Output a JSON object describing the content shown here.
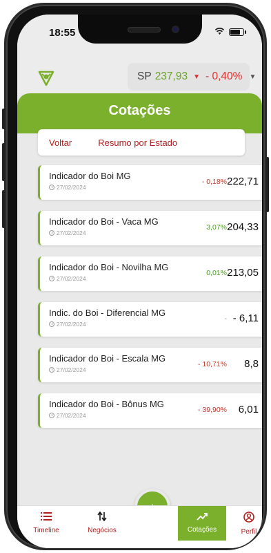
{
  "status": {
    "time": "18:55"
  },
  "header": {
    "quote_label": "SP",
    "quote_value": "237,93",
    "quote_change": "- 0,40%"
  },
  "page": {
    "title": "Cotações"
  },
  "subbar": {
    "back_label": "Voltar",
    "summary_label": "Resumo por Estado"
  },
  "items": [
    {
      "name": "Indicador do Boi MG",
      "date": "27/02/2024",
      "change": "- 0,18%",
      "trend": "negative",
      "price": "222,71"
    },
    {
      "name": "Indicador do Boi - Vaca MG",
      "date": "27/02/2024",
      "change": "3,07%",
      "trend": "positive",
      "price": "204,33"
    },
    {
      "name": "Indicador do Boi - Novilha MG",
      "date": "27/02/2024",
      "change": "0,01%",
      "trend": "positive",
      "price": "213,05"
    },
    {
      "name": "Indic. do Boi - Diferencial MG",
      "date": "27/02/2024",
      "change": "-",
      "trend": "neutral",
      "price": "- 6,11"
    },
    {
      "name": "Indicador do Boi - Escala MG",
      "date": "27/02/2024",
      "change": "- 10,71%",
      "trend": "negative",
      "price": "8,8"
    },
    {
      "name": "Indicador do Boi - Bônus MG",
      "date": "27/02/2024",
      "change": "- 39,90%",
      "trend": "negative",
      "price": "6,01"
    }
  ],
  "nav": {
    "timeline": "Timeline",
    "negocios": "Negócios",
    "cotacoes": "Cotações",
    "perfil": "Perfil",
    "add_symbol": "+"
  },
  "colors": {
    "accent": "#7bb02c",
    "negative": "#c0392b",
    "positive": "#4a9b1f",
    "link": "#b01e1e"
  },
  "icons": [
    "logo-icon",
    "arrow-down-icon",
    "chevron-down-icon",
    "clock-icon",
    "list-icon",
    "swap-arrows-icon",
    "trend-icon",
    "user-icon",
    "plus-icon"
  ]
}
